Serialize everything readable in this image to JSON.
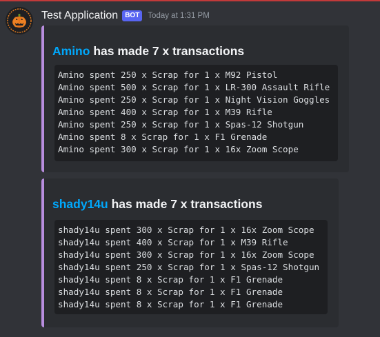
{
  "message": {
    "author": "Test Application",
    "bot_tag": "BOT",
    "timestamp": "Today at 1:31 PM",
    "avatar_icon": "pumpkin-logo-icon"
  },
  "embeds": [
    {
      "name": "Amino",
      "title_suffix": " has made 7 x transactions",
      "accent_color": "#b88dde",
      "lines": [
        "Amino spent 250 x Scrap for 1 x M92 Pistol",
        "Amino spent 500 x Scrap for 1 x LR-300 Assault Rifle",
        "Amino spent 250 x Scrap for 1 x Night Vision Goggles",
        "Amino spent 400 x Scrap for 1 x M39 Rifle",
        "Amino spent 250 x Scrap for 1 x Spas-12 Shotgun",
        "Amino spent 8 x Scrap for 1 x F1 Grenade",
        "Amino spent 300 x Scrap for 1 x 16x Zoom Scope"
      ]
    },
    {
      "name": "shady14u",
      "title_suffix": " has made 7 x transactions",
      "accent_color": "#b88dde",
      "lines": [
        "shady14u spent 300 x Scrap for 1 x 16x Zoom Scope",
        "shady14u spent 400 x Scrap for 1 x M39 Rifle",
        "shady14u spent 300 x Scrap for 1 x 16x Zoom Scope",
        "shady14u spent 250 x Scrap for 1 x Spas-12 Shotgun",
        "shady14u spent 8 x Scrap for 1 x F1 Grenade",
        "shady14u spent 8 x Scrap for 1 x F1 Grenade",
        "shady14u spent 8 x Scrap for 1 x F1 Grenade"
      ]
    }
  ],
  "colors": {
    "background": "#313338",
    "embed_background": "#2b2d31",
    "code_background": "#1e1f22",
    "name_link": "#00a8fc",
    "bot_tag": "#5865f2"
  }
}
